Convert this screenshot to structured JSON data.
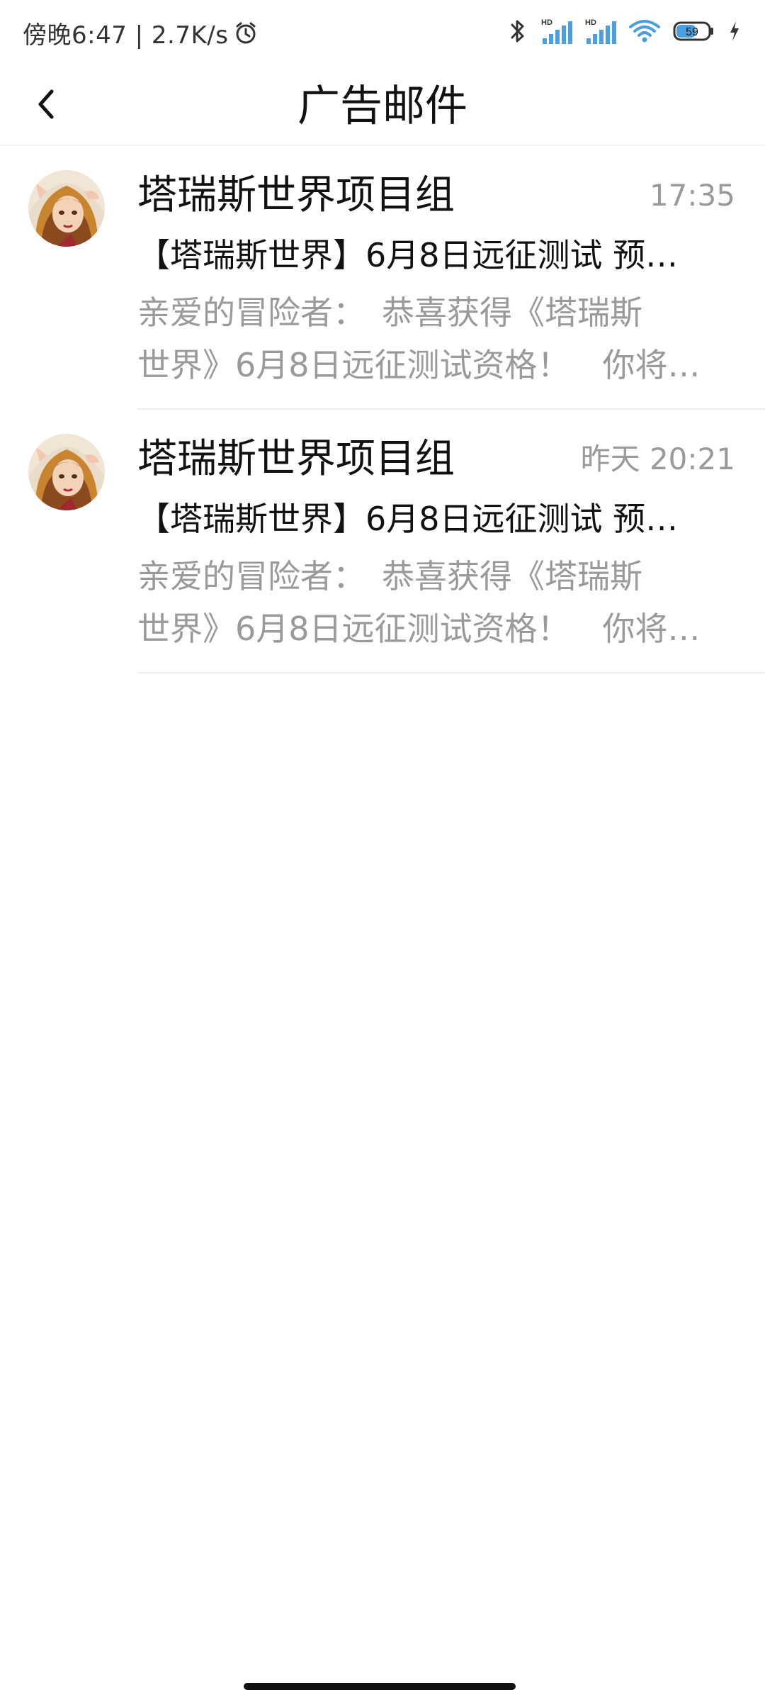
{
  "status_bar": {
    "time_text": "傍晚6:47 | 2.7K/s",
    "alarm_icon": "alarm-clock-icon",
    "bluetooth_icon": "bluetooth-icon",
    "signal1_label": "HD",
    "signal2_label": "HD",
    "wifi_icon": "wifi-icon",
    "battery_level": "59",
    "charging_icon": "lightning-icon"
  },
  "header": {
    "back_icon": "chevron-left-icon",
    "title": "广告邮件"
  },
  "mails": [
    {
      "avatar": "avatar-icon",
      "sender": "塔瑞斯世界项目组",
      "time": "17:35",
      "subject": "【塔瑞斯世界】6月8日远征测试 预…",
      "preview_line1": "亲爱的冒险者：　恭喜获得《塔瑞斯",
      "preview_line2": "世界》6月8日远征测试资格！　你将…"
    },
    {
      "avatar": "avatar-icon",
      "sender": "塔瑞斯世界项目组",
      "time": "昨天 20:21",
      "subject": "【塔瑞斯世界】6月8日远征测试 预…",
      "preview_line1": "亲爱的冒险者：　恭喜获得《塔瑞斯",
      "preview_line2": "世界》6月8日远征测试资格！　你将…"
    }
  ],
  "colors": {
    "text_primary": "#111111",
    "text_secondary": "#9a9a9a",
    "divider": "#ededed",
    "signal_blue": "#4a9fe0"
  }
}
